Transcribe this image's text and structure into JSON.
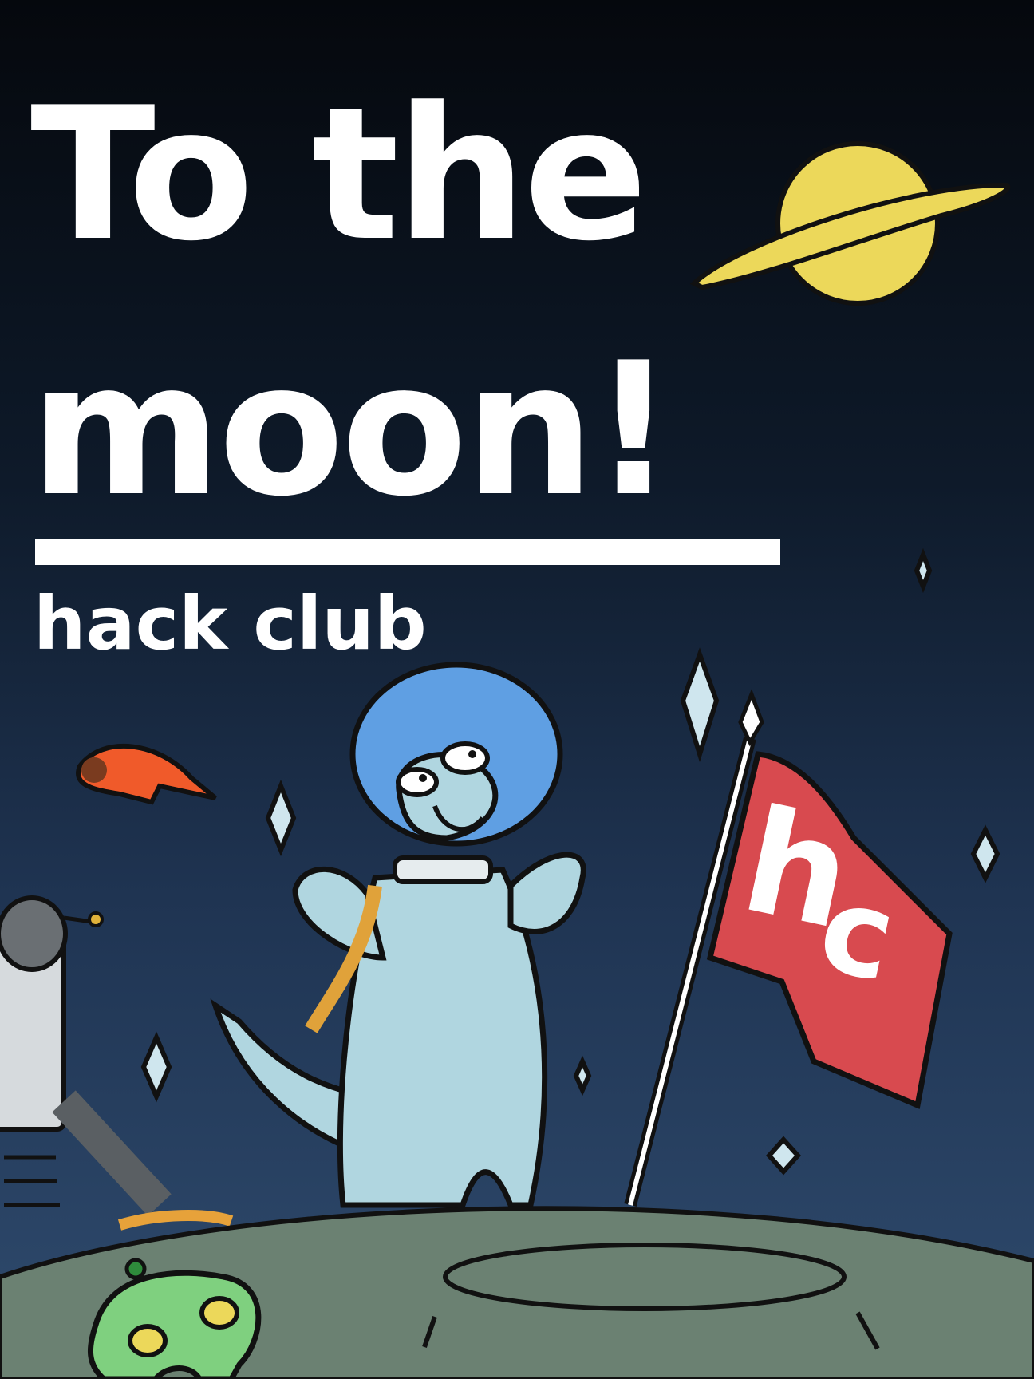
{
  "poster": {
    "title_line1": "To the",
    "title_line2": "moon!",
    "subtitle": "hack club",
    "flag_letters": [
      "h",
      "c"
    ]
  },
  "colors": {
    "sky_top": "#05080d",
    "sky_bottom": "#2f4b6e",
    "text": "#ffffff",
    "planet": "#ecd85a",
    "moon_surface": "#6b8172",
    "dino_body": "#b0d6e0",
    "helmet": "#5f9fe3",
    "flag": "#d84a4f",
    "alien": "#7fd07f",
    "comet": "#f05a2a"
  }
}
